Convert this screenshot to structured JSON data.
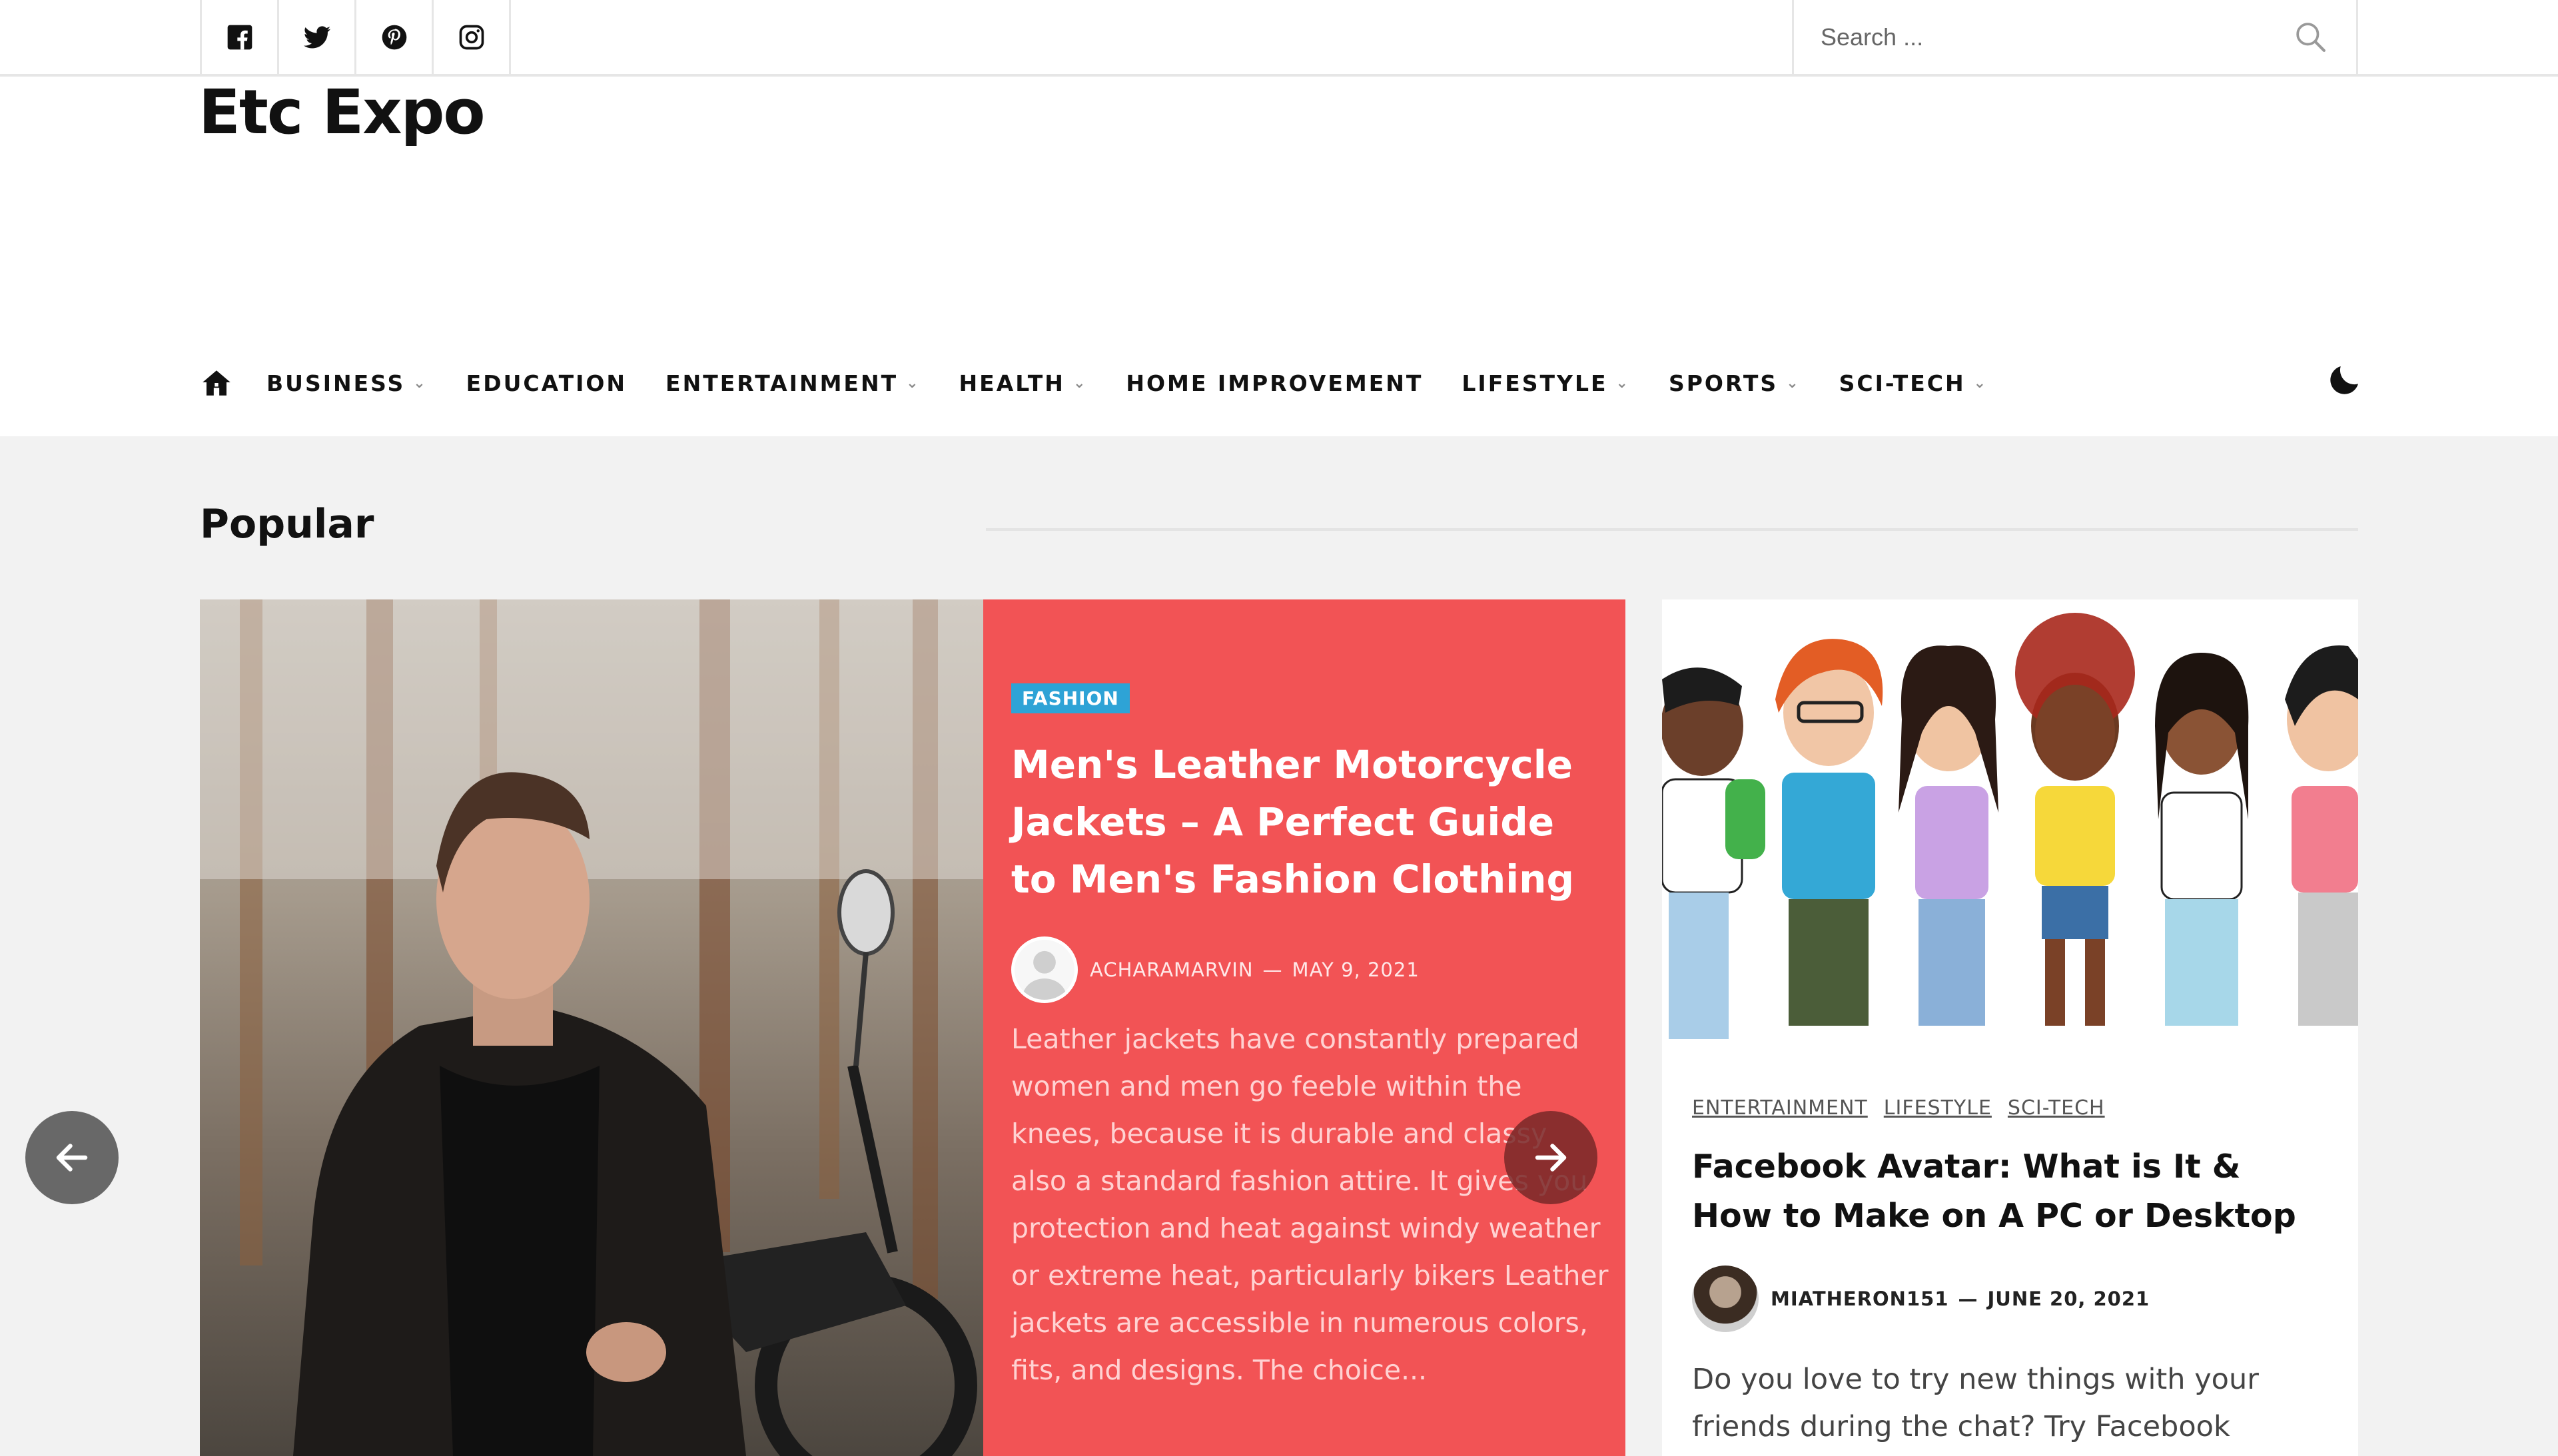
{
  "social": {
    "items": [
      {
        "name": "facebook-icon"
      },
      {
        "name": "twitter-icon"
      },
      {
        "name": "pinterest-icon"
      },
      {
        "name": "instagram-icon"
      }
    ]
  },
  "search": {
    "placeholder": "Search ..."
  },
  "site": {
    "title": "Etc Expo"
  },
  "nav": {
    "items": [
      {
        "label": "BUSINESS",
        "has_dropdown": true
      },
      {
        "label": "EDUCATION",
        "has_dropdown": false
      },
      {
        "label": "ENTERTAINMENT",
        "has_dropdown": true
      },
      {
        "label": "HEALTH",
        "has_dropdown": true
      },
      {
        "label": "HOME IMPROVEMENT",
        "has_dropdown": false
      },
      {
        "label": "LIFESTYLE",
        "has_dropdown": true
      },
      {
        "label": "SPORTS",
        "has_dropdown": true
      },
      {
        "label": "SCI-TECH",
        "has_dropdown": true
      }
    ],
    "chevron": "⌄"
  },
  "section": {
    "title": "Popular"
  },
  "featured": {
    "category": "FASHION",
    "title": "Men's Leather Motorcycle Jackets – A Perfect Guide to Men's Fashion Clothing",
    "author": "ACHARAMARVIN",
    "separator": "—",
    "date": "MAY 9, 2021",
    "excerpt": "Leather jackets have constantly prepared women and men go feeble within the knees, because it is durable and classy also a standard fashion attire. It gives you protection and heat against windy weather or extreme heat, particularly bikers Leather jackets are accessible in numerous colors, fits, and designs. The choice..."
  },
  "side_card": {
    "categories": [
      "ENTERTAINMENT",
      "LIFESTYLE",
      "SCI-TECH"
    ],
    "title": "Facebook Avatar: What is It & How to Make on A PC or Desktop",
    "author": "MIATHERON151",
    "separator": "—",
    "date": "JUNE 20, 2021",
    "excerpt": "Do you love to try new things with your friends during the chat? Try Facebook avatar to make"
  },
  "colors": {
    "accent": "#f25355",
    "badge": "#2ea3d6"
  }
}
